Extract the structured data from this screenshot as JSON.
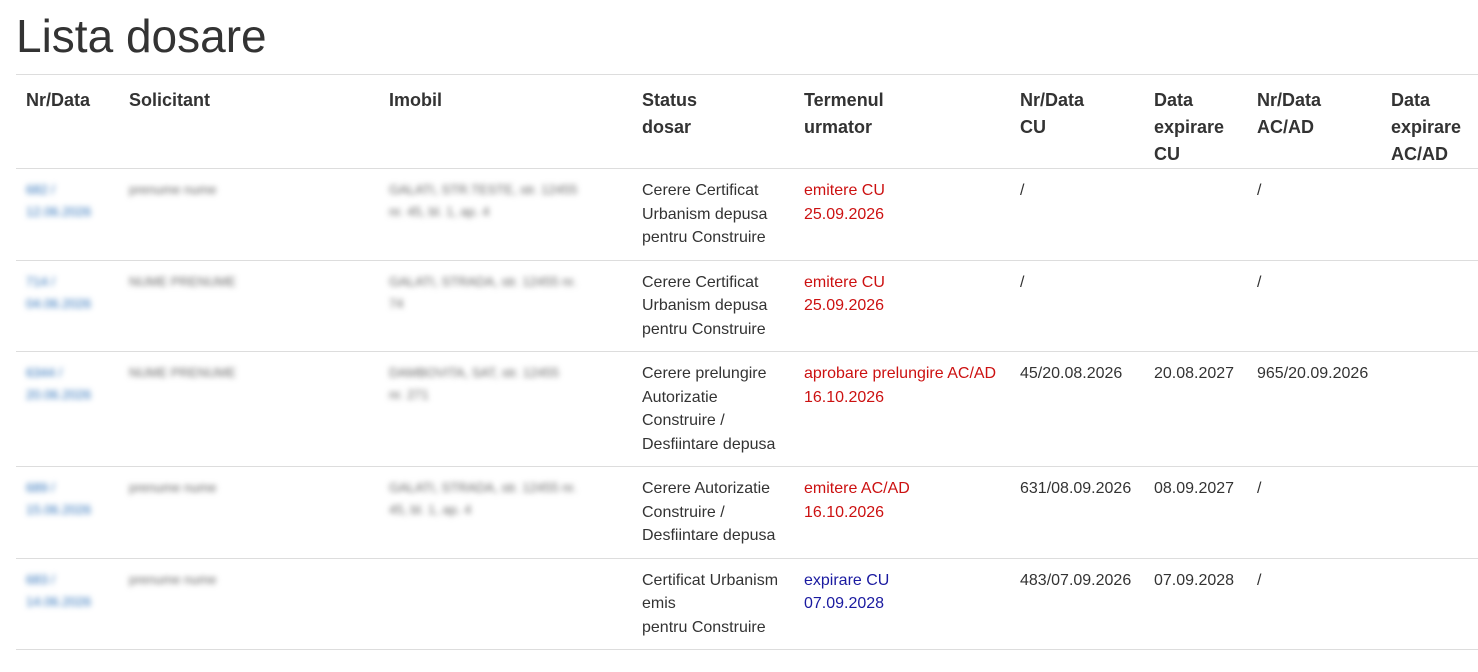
{
  "page": {
    "title": "Lista dosare"
  },
  "table": {
    "headers": [
      [
        "Nr/Data"
      ],
      [
        "Solicitant"
      ],
      [
        "Imobil"
      ],
      [
        "Status",
        "dosar"
      ],
      [
        "Termenul",
        "urmator"
      ],
      [
        "Nr/Data",
        "CU"
      ],
      [
        "Data",
        "expirare",
        "CU"
      ],
      [
        "Nr/Data",
        "AC/AD"
      ],
      [
        "Data",
        "expirare",
        "AC/AD"
      ]
    ],
    "rows": [
      {
        "nr_data": [
          "682 /",
          "12.06.2026"
        ],
        "solicitant": "prenume nume",
        "imobil": [
          "GALATI, STR.TESTE, str. 12455",
          "nr. 45, bl. 1, ap. 4"
        ],
        "status": [
          "Cerere Certificat",
          "Urbanism depusa",
          "pentru Construire"
        ],
        "termen": [
          "emitere CU",
          "25.09.2026"
        ],
        "termen_color": "red",
        "nr_cu": "/",
        "exp_cu": "",
        "nr_ac": "/",
        "exp_ac": ""
      },
      {
        "nr_data": [
          "714 /",
          "04.06.2026"
        ],
        "solicitant": "NUME PRENUME",
        "imobil": [
          "GALATI, STRADA, str. 12455 nr.",
          "74"
        ],
        "status": [
          "Cerere Certificat",
          "Urbanism depusa",
          "pentru Construire"
        ],
        "termen": [
          "emitere CU",
          "25.09.2026"
        ],
        "termen_color": "red",
        "nr_cu": "/",
        "exp_cu": "",
        "nr_ac": "/",
        "exp_ac": ""
      },
      {
        "nr_data": [
          "6344 /",
          "20.06.2026"
        ],
        "solicitant": "NUME PRENUME",
        "imobil": [
          "DAMBOVITA, SAT, str. 12455",
          "nr. 271"
        ],
        "status": [
          "Cerere prelungire",
          "Autorizatie",
          "Construire /",
          "Desfiintare depusa"
        ],
        "termen": [
          "aprobare prelungire AC/AD",
          "16.10.2026"
        ],
        "termen_color": "red",
        "nr_cu": "45/20.08.2026",
        "exp_cu": "20.08.2027",
        "nr_ac": "965/20.09.2026",
        "exp_ac": ""
      },
      {
        "nr_data": [
          "689 /",
          "15.06.2026"
        ],
        "solicitant": "prenume nume",
        "imobil": [
          "GALATI, STRADA, str. 12455 nr.",
          "45, bl. 1, ap. 4"
        ],
        "status": [
          "Cerere Autorizatie",
          "Construire /",
          "Desfiintare depusa"
        ],
        "termen": [
          "emitere AC/AD",
          "16.10.2026"
        ],
        "termen_color": "red",
        "nr_cu": "631/08.09.2026",
        "exp_cu": "08.09.2027",
        "nr_ac": "/",
        "exp_ac": ""
      },
      {
        "nr_data": [
          "683 /",
          "14.06.2026"
        ],
        "solicitant": "prenume nume",
        "imobil": [],
        "status": [
          "Certificat Urbanism",
          "emis",
          "pentru Construire"
        ],
        "termen": [
          "expirare CU",
          "07.09.2028"
        ],
        "termen_color": "blue",
        "nr_cu": "483/07.09.2026",
        "exp_cu": "07.09.2028",
        "nr_ac": "/",
        "exp_ac": ""
      }
    ]
  },
  "colors": {
    "text": "#333333",
    "link": "#2a6fb8",
    "term_red": "#cc1111",
    "term_blue": "#1a1aa0",
    "border": "#dddddd"
  }
}
